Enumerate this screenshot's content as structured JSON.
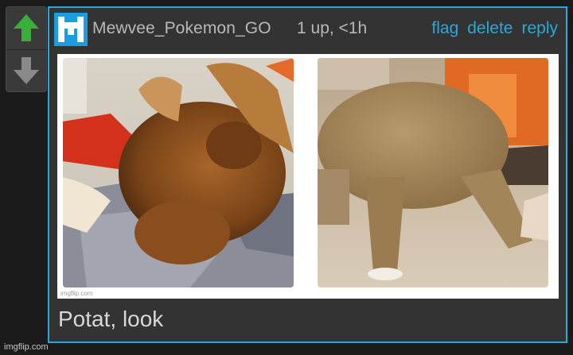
{
  "vote": {
    "up_icon": "arrow-up-icon",
    "down_icon": "arrow-down-icon",
    "up_color": "#3aae3a",
    "down_color": "#8a8a8a"
  },
  "comment": {
    "username": "Mewvee_Pokemon_GO",
    "meta": "1 up, <1h",
    "actions": {
      "flag": "flag",
      "delete": "delete",
      "reply": "reply"
    },
    "avatar_icon": "user-avatar-icon",
    "image_watermark": "imgflip.com",
    "caption": "Potat, look",
    "accent_color": "#2aa8d8"
  },
  "footer": {
    "watermark": "imgflip.com"
  }
}
